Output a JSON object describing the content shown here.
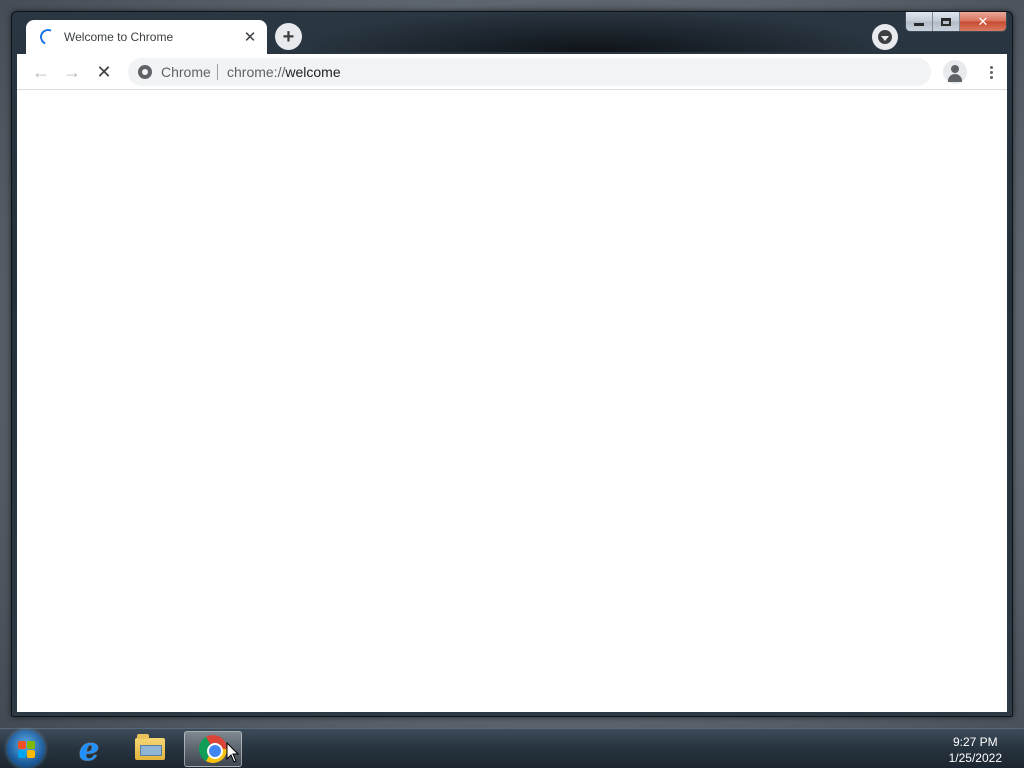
{
  "window": {
    "tab": {
      "title": "Welcome to Chrome"
    },
    "caption": {
      "minimize": "minimize",
      "maximize": "maximize",
      "close": "close"
    }
  },
  "toolbar": {
    "chip_label": "Chrome",
    "url_scheme": "chrome://",
    "url_host": "welcome"
  },
  "taskbar": {
    "items": [
      "internet-explorer",
      "windows-explorer",
      "google-chrome"
    ],
    "active_item": "google-chrome",
    "clock": {
      "time": "9:27 PM",
      "date": "1/25/2022"
    }
  },
  "colors": {
    "accent": "#1a73e8",
    "omnibox_bg": "#f1f3f4",
    "text": "#3c4043"
  }
}
